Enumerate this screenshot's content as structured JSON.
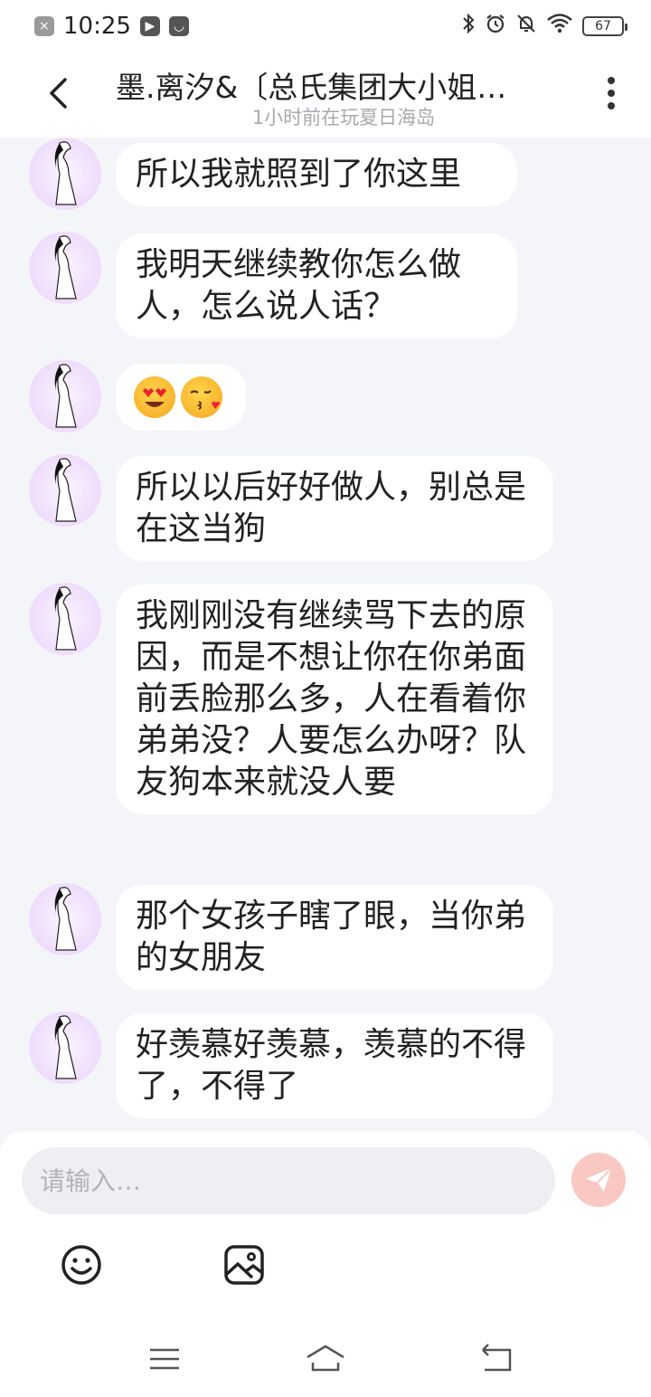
{
  "status_bar": {
    "time": "10:25",
    "battery": "67"
  },
  "header": {
    "title": "墨.离汐&〔总氏集团大小姐…",
    "subtitle": "1小时前在玩夏日海岛"
  },
  "messages": [
    {
      "text": "所以我就照到了你这里"
    },
    {
      "text": "我明天继续教你怎么做人，怎么说人话？"
    },
    {
      "emojis": [
        "heart-eyes-emoji",
        "kissing-heart-emoji"
      ]
    },
    {
      "text": "所以以后好好做人，别总是在这当狗"
    },
    {
      "text": "我刚刚没有继续骂下去的原因，而是不想让你在你弟面前丢脸那么多，人在看着你弟弟没？人要怎么办呀？队友狗本来就没人要"
    },
    {
      "text": "那个女孩子瞎了眼，当你弟的女朋友"
    },
    {
      "text": "好羡慕好羡慕，羡慕的不得了，不得了"
    }
  ],
  "input": {
    "placeholder": "请输入…"
  },
  "colors": {
    "background": "#f4f5f9",
    "bubble": "#ffffff",
    "send_button": "#f9c8c3"
  }
}
